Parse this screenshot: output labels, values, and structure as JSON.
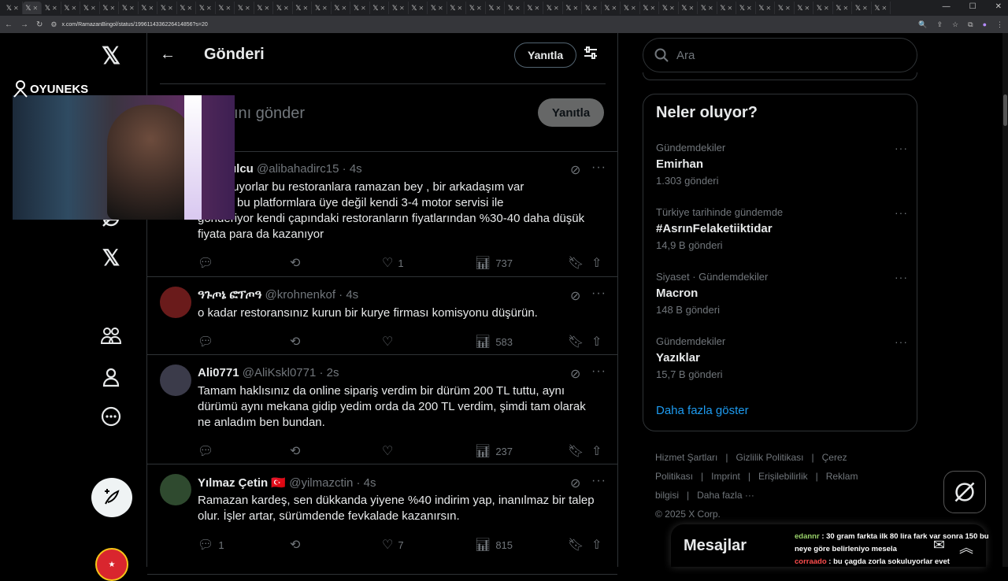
{
  "browser": {
    "url": "x.com/RamazanBingol/status/1996114336226414856?s=20",
    "tab_count": 46
  },
  "leftnav": {
    "x_logo": "𝕏"
  },
  "overlay": {
    "logo_text": "OYUNEKS"
  },
  "header": {
    "title": "Gönderi",
    "reply_button": "Yanıtla"
  },
  "composer": {
    "placeholder_fragment": "ını gönder",
    "reply_button": "Yanıtla"
  },
  "tweets": [
    {
      "name": "f Dawulcu",
      "handle": "@alibahadirc15",
      "time": "· 4s",
      "lines": [
        "ını sokuyorlar bu restoranlara ramazan bey , bir arkadaşım var",
        "anı var bu platformlara üye değil kendi 3-4 motor servisi ile",
        "gönderiyor kendi çapındaki restoranların fiyatlarından %30-40 daha düşük",
        "fiyata para da kazanıyor"
      ],
      "replies": "",
      "retweets": "",
      "likes": "1",
      "views": "737"
    },
    {
      "name": "ዓጉጦኔ ፎፕጦዓ",
      "handle": "@krohnenkof",
      "time": "· 4s",
      "lines": [
        "o kadar restoransınız kurun bir kurye firması komisyonu düşürün."
      ],
      "replies": "",
      "retweets": "",
      "likes": "",
      "views": "583"
    },
    {
      "name": "Ali0771",
      "handle": "@AliKskl0771",
      "time": "· 2s",
      "lines": [
        "Tamam haklısınız da online sipariş verdim bir dürüm 200 TL tuttu, aynı",
        "dürümü aynı mekana gidip yedim orda da 200 TL verdim, şimdi tam olarak",
        "ne anladım ben bundan."
      ],
      "replies": "",
      "retweets": "",
      "likes": "",
      "views": "237"
    },
    {
      "name": "Yılmaz Çetin",
      "flag": "🇹🇷",
      "handle": "@yilmazctin",
      "time": "· 4s",
      "lines": [
        "Ramazan kardeş, sen dükkanda yiyene %40 indirim yap, inanılmaz bir talep",
        "olur. İşler artar, sürümdende fevkalade kazanırsın."
      ],
      "replies": "1",
      "retweets": "",
      "likes": "7",
      "views": "815"
    }
  ],
  "search": {
    "placeholder": "Ara"
  },
  "trends": {
    "title": "Neler oluyor?",
    "items": [
      {
        "category": "Gündemdekiler",
        "name": "Emirhan",
        "count": "1.303 gönderi"
      },
      {
        "category": "Türkiye tarihinde gündemde",
        "name": "#AsrınFelaketiiktidar",
        "count": "14,9 B gönderi"
      },
      {
        "category": "Siyaset · Gündemdekiler",
        "name": "Macron",
        "count": "148 B gönderi"
      },
      {
        "category": "Gündemdekiler",
        "name": "Yazıklar",
        "count": "15,7 B gönderi"
      }
    ],
    "show_more": "Daha fazla göster"
  },
  "footer": {
    "links": [
      "Hizmet Şartları",
      "|",
      "Gizlilik Politikası",
      "|",
      "Çerez Politikası",
      "|",
      "Imprint",
      "|",
      "Erişilebilirlik",
      "|",
      "Reklam bilgisi",
      "|",
      "Daha fazla ···"
    ],
    "copyright": "© 2025 X Corp."
  },
  "messages": {
    "title": "Mesajlar"
  },
  "chat": [
    {
      "user": "edannr",
      "text": ": 30 gram farkta ilk 80 lira fark var sonra 150 bu neye göre belirleniyo mesela",
      "color": "#9ad36a"
    },
    {
      "user": "corraado",
      "text": ": bu çagda zorla sokuluyorlar evet",
      "color": "#ff4d4d"
    }
  ]
}
